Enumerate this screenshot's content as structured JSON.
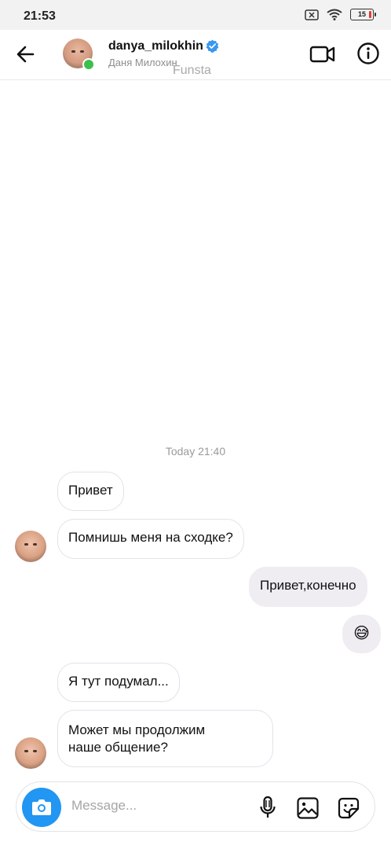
{
  "status_bar": {
    "time": "21:53",
    "battery": "15"
  },
  "header": {
    "username": "danya_milokhin",
    "full_name": "Даня Милохин",
    "watermark": "Funsta",
    "online": true
  },
  "chat": {
    "timestamp": "Today 21:40",
    "messages": [
      {
        "from": "them",
        "text": "Привет"
      },
      {
        "from": "them",
        "text": "Помнишь меня на сходке?"
      },
      {
        "from": "me",
        "text": "Привет,конечно"
      },
      {
        "from": "me",
        "text": "😅"
      },
      {
        "from": "them",
        "text": "Я тут подумал..."
      },
      {
        "from": "them",
        "text_line1": "Может мы продолжим",
        "text_line2": "наше общение?"
      }
    ]
  },
  "composer": {
    "placeholder": "Message...",
    "value": ""
  },
  "icons": {
    "back": "arrow-left-icon",
    "verified": "verified-badge-icon",
    "video": "video-camera-icon",
    "info": "info-icon",
    "camera": "camera-icon",
    "mic": "microphone-icon",
    "gallery": "image-icon",
    "sticker": "sticker-icon"
  },
  "colors": {
    "accent": "#2196f3",
    "online": "#3dbf4e",
    "battery_low": "#e53935",
    "outgoing_bubble": "#efedf1"
  }
}
